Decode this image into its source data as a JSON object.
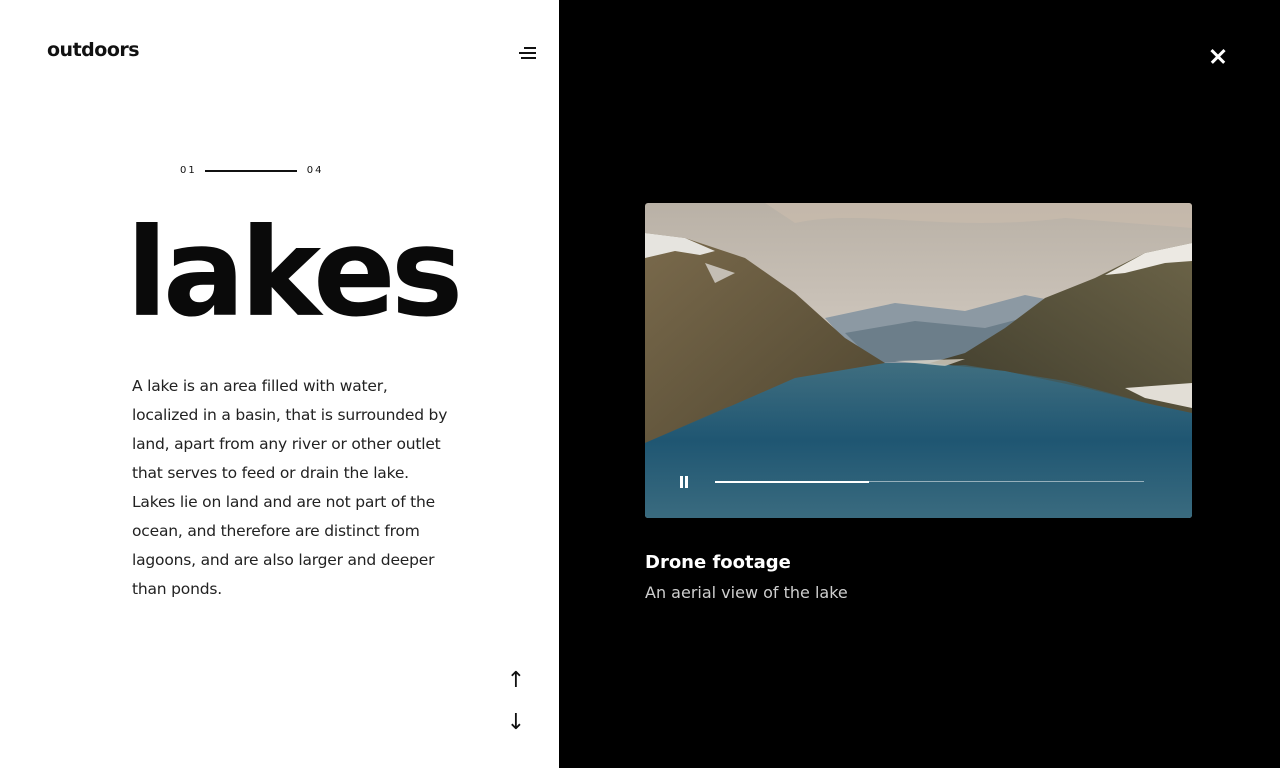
{
  "brand": {
    "logo_text": "outdoors"
  },
  "pager": {
    "current": "01",
    "total": "04"
  },
  "article": {
    "title": "lakes",
    "description": "A lake is an area filled with water, localized in a basin, that is surrounded by land, apart from any river or other outlet that serves to feed or drain the lake. Lakes lie on land and are not part of the ocean, and therefore are distinct from lagoons, and are also larger and deeper than ponds."
  },
  "navigation": {
    "up_icon": "arrow-up-icon",
    "down_icon": "arrow-down-icon",
    "up_glyph": "↑",
    "down_glyph": "↓"
  },
  "video": {
    "title": "Drone footage",
    "subtitle": "An aerial view of the lake",
    "progress": 0.36
  },
  "icons": {
    "menu": "menu-icon",
    "close": "close-icon",
    "pause": "pause-icon"
  },
  "colors": {
    "left_bg": "#ffffff",
    "right_bg": "#000000",
    "text": "#111111"
  }
}
